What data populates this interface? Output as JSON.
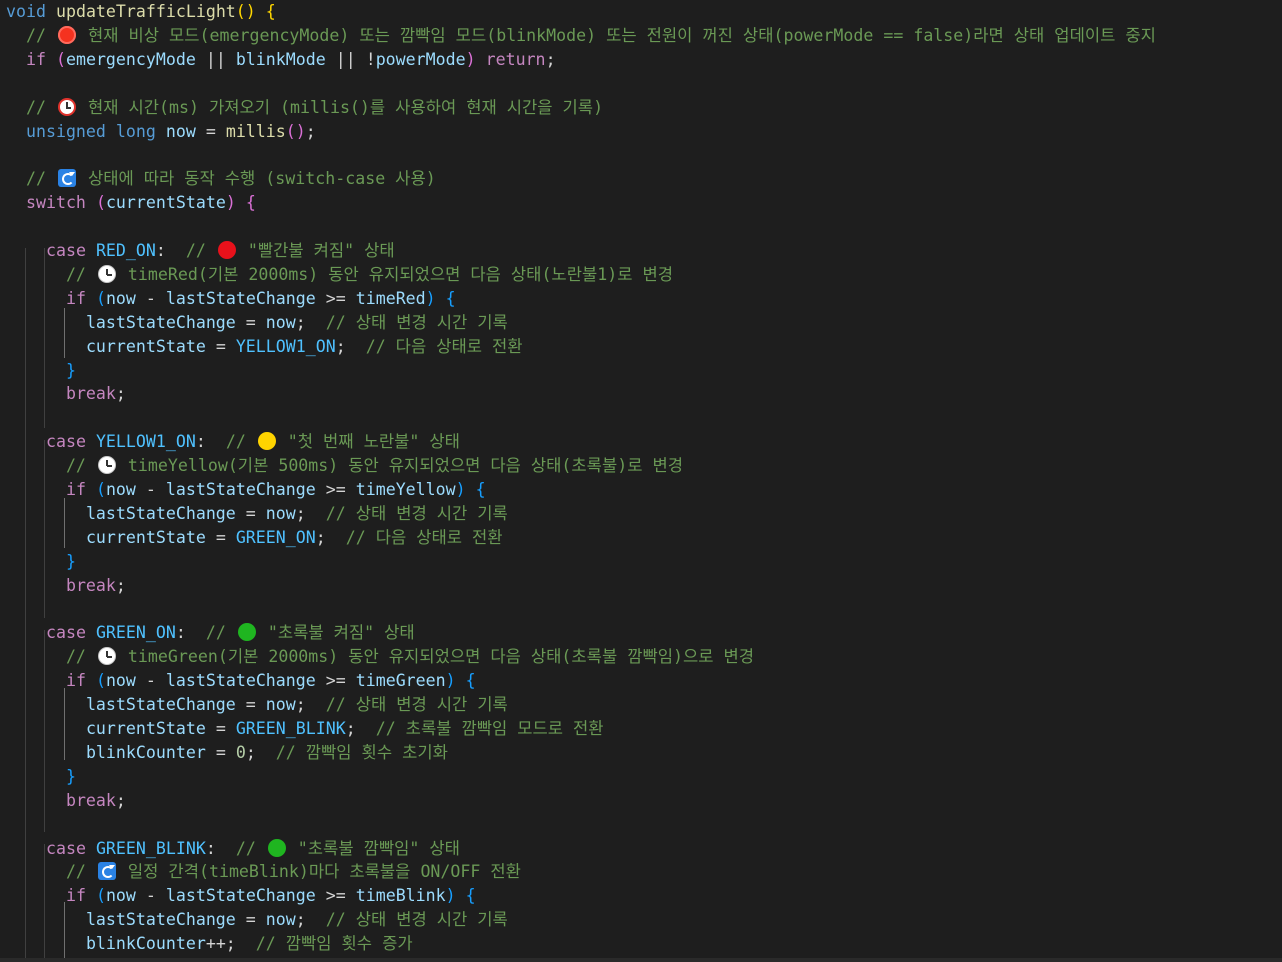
{
  "editor": {
    "theme_colors": {
      "background": "#1e1e1e",
      "keyword": "#569cd6",
      "control": "#c586c0",
      "function": "#dcdcaa",
      "variable": "#9cdcfe",
      "constant": "#4fc1ff",
      "number": "#b5cea8",
      "comment": "#6a9955",
      "string": "#ce9178"
    },
    "lines": [
      {
        "tokens": [
          [
            "kw",
            "void"
          ],
          [
            "pl",
            " "
          ],
          [
            "fn",
            "updateTrafficLight"
          ],
          [
            "br1",
            "()"
          ],
          [
            "pl",
            " "
          ],
          [
            "br1",
            "{"
          ]
        ]
      },
      {
        "tokens": [
          [
            "cmt",
            "  // "
          ],
          [
            "emoji",
            "stop"
          ],
          [
            "cmt",
            " 현재 비상 모드(emergencyMode) 또는 깜빡임 모드(blinkMode) 또는 전원이 꺼진 상태(powerMode == false)라면 상태 업데이트 중지"
          ]
        ]
      },
      {
        "tokens": [
          [
            "pl",
            "  "
          ],
          [
            "ctl",
            "if"
          ],
          [
            "pl",
            " "
          ],
          [
            "br2",
            "("
          ],
          [
            "var",
            "emergencyMode"
          ],
          [
            "pl",
            " || "
          ],
          [
            "var",
            "blinkMode"
          ],
          [
            "pl",
            " || !"
          ],
          [
            "var",
            "powerMode"
          ],
          [
            "br2",
            ")"
          ],
          [
            "pl",
            " "
          ],
          [
            "ctl",
            "return"
          ],
          [
            "pl",
            ";"
          ]
        ]
      },
      {
        "tokens": []
      },
      {
        "tokens": [
          [
            "cmt",
            "  // "
          ],
          [
            "emoji",
            "alarm"
          ],
          [
            "cmt",
            " 현재 시간(ms) 가져오기 (millis()를 사용하여 현재 시간을 기록)"
          ]
        ]
      },
      {
        "tokens": [
          [
            "pl",
            "  "
          ],
          [
            "kw",
            "unsigned long"
          ],
          [
            "pl",
            " "
          ],
          [
            "var",
            "now"
          ],
          [
            "pl",
            " = "
          ],
          [
            "fn",
            "millis"
          ],
          [
            "br2",
            "()"
          ],
          [
            "pl",
            ";"
          ]
        ]
      },
      {
        "tokens": []
      },
      {
        "tokens": [
          [
            "cmt",
            "  // "
          ],
          [
            "emoji",
            "cycle"
          ],
          [
            "cmt",
            " 상태에 따라 동작 수행 (switch-case 사용)"
          ]
        ]
      },
      {
        "tokens": [
          [
            "pl",
            "  "
          ],
          [
            "ctl",
            "switch"
          ],
          [
            "pl",
            " "
          ],
          [
            "br2",
            "("
          ],
          [
            "var",
            "currentState"
          ],
          [
            "br2",
            ")"
          ],
          [
            "pl",
            " "
          ],
          [
            "br2",
            "{"
          ]
        ]
      },
      {
        "tokens": []
      },
      {
        "tokens": [
          [
            "pl",
            "    "
          ],
          [
            "ctl",
            "case"
          ],
          [
            "pl",
            " "
          ],
          [
            "cst",
            "RED_ON"
          ],
          [
            "pl",
            ":  "
          ],
          [
            "cmt",
            "// "
          ],
          [
            "emoji",
            "red"
          ],
          [
            "cmt",
            " \"빨간불 켜짐\" 상태"
          ]
        ]
      },
      {
        "tokens": [
          [
            "cmt",
            "      // "
          ],
          [
            "emoji",
            "clock"
          ],
          [
            "cmt",
            " timeRed(기본 2000ms) 동안 유지되었으면 다음 상태(노란불1)로 변경"
          ]
        ]
      },
      {
        "tokens": [
          [
            "pl",
            "      "
          ],
          [
            "ctl",
            "if"
          ],
          [
            "pl",
            " "
          ],
          [
            "br3",
            "("
          ],
          [
            "var",
            "now"
          ],
          [
            "pl",
            " - "
          ],
          [
            "var",
            "lastStateChange"
          ],
          [
            "pl",
            " >= "
          ],
          [
            "var",
            "timeRed"
          ],
          [
            "br3",
            ")"
          ],
          [
            "pl",
            " "
          ],
          [
            "br3",
            "{"
          ]
        ]
      },
      {
        "tokens": [
          [
            "pl",
            "        "
          ],
          [
            "var",
            "lastStateChange"
          ],
          [
            "pl",
            " = "
          ],
          [
            "var",
            "now"
          ],
          [
            "pl",
            ";  "
          ],
          [
            "cmt",
            "// 상태 변경 시간 기록"
          ]
        ]
      },
      {
        "tokens": [
          [
            "pl",
            "        "
          ],
          [
            "var",
            "currentState"
          ],
          [
            "pl",
            " = "
          ],
          [
            "cst",
            "YELLOW1_ON"
          ],
          [
            "pl",
            ";  "
          ],
          [
            "cmt",
            "// 다음 상태로 전환"
          ]
        ]
      },
      {
        "tokens": [
          [
            "pl",
            "      "
          ],
          [
            "br3",
            "}"
          ]
        ]
      },
      {
        "tokens": [
          [
            "pl",
            "      "
          ],
          [
            "ctl",
            "break"
          ],
          [
            "pl",
            ";"
          ]
        ]
      },
      {
        "tokens": []
      },
      {
        "tokens": [
          [
            "pl",
            "    "
          ],
          [
            "ctl",
            "case"
          ],
          [
            "pl",
            " "
          ],
          [
            "cst",
            "YELLOW1_ON"
          ],
          [
            "pl",
            ":  "
          ],
          [
            "cmt",
            "// "
          ],
          [
            "emoji",
            "yellow"
          ],
          [
            "cmt",
            " \"첫 번째 노란불\" 상태"
          ]
        ]
      },
      {
        "tokens": [
          [
            "cmt",
            "      // "
          ],
          [
            "emoji",
            "clock"
          ],
          [
            "cmt",
            " timeYellow(기본 500ms) 동안 유지되었으면 다음 상태(초록불)로 변경"
          ]
        ]
      },
      {
        "tokens": [
          [
            "pl",
            "      "
          ],
          [
            "ctl",
            "if"
          ],
          [
            "pl",
            " "
          ],
          [
            "br3",
            "("
          ],
          [
            "var",
            "now"
          ],
          [
            "pl",
            " - "
          ],
          [
            "var",
            "lastStateChange"
          ],
          [
            "pl",
            " >= "
          ],
          [
            "var",
            "timeYellow"
          ],
          [
            "br3",
            ")"
          ],
          [
            "pl",
            " "
          ],
          [
            "br3",
            "{"
          ]
        ]
      },
      {
        "tokens": [
          [
            "pl",
            "        "
          ],
          [
            "var",
            "lastStateChange"
          ],
          [
            "pl",
            " = "
          ],
          [
            "var",
            "now"
          ],
          [
            "pl",
            ";  "
          ],
          [
            "cmt",
            "// 상태 변경 시간 기록"
          ]
        ]
      },
      {
        "tokens": [
          [
            "pl",
            "        "
          ],
          [
            "var",
            "currentState"
          ],
          [
            "pl",
            " = "
          ],
          [
            "cst",
            "GREEN_ON"
          ],
          [
            "pl",
            ";  "
          ],
          [
            "cmt",
            "// 다음 상태로 전환"
          ]
        ]
      },
      {
        "tokens": [
          [
            "pl",
            "      "
          ],
          [
            "br3",
            "}"
          ]
        ]
      },
      {
        "tokens": [
          [
            "pl",
            "      "
          ],
          [
            "ctl",
            "break"
          ],
          [
            "pl",
            ";"
          ]
        ]
      },
      {
        "tokens": []
      },
      {
        "tokens": [
          [
            "pl",
            "    "
          ],
          [
            "ctl",
            "case"
          ],
          [
            "pl",
            " "
          ],
          [
            "cst",
            "GREEN_ON"
          ],
          [
            "pl",
            ":  "
          ],
          [
            "cmt",
            "// "
          ],
          [
            "emoji",
            "green"
          ],
          [
            "cmt",
            " \"초록불 켜짐\" 상태"
          ]
        ]
      },
      {
        "tokens": [
          [
            "cmt",
            "      // "
          ],
          [
            "emoji",
            "clock"
          ],
          [
            "cmt",
            " timeGreen(기본 2000ms) 동안 유지되었으면 다음 상태(초록불 깜빡임)으로 변경"
          ]
        ]
      },
      {
        "tokens": [
          [
            "pl",
            "      "
          ],
          [
            "ctl",
            "if"
          ],
          [
            "pl",
            " "
          ],
          [
            "br3",
            "("
          ],
          [
            "var",
            "now"
          ],
          [
            "pl",
            " - "
          ],
          [
            "var",
            "lastStateChange"
          ],
          [
            "pl",
            " >= "
          ],
          [
            "var",
            "timeGreen"
          ],
          [
            "br3",
            ")"
          ],
          [
            "pl",
            " "
          ],
          [
            "br3",
            "{"
          ]
        ]
      },
      {
        "tokens": [
          [
            "pl",
            "        "
          ],
          [
            "var",
            "lastStateChange"
          ],
          [
            "pl",
            " = "
          ],
          [
            "var",
            "now"
          ],
          [
            "pl",
            ";  "
          ],
          [
            "cmt",
            "// 상태 변경 시간 기록"
          ]
        ]
      },
      {
        "tokens": [
          [
            "pl",
            "        "
          ],
          [
            "var",
            "currentState"
          ],
          [
            "pl",
            " = "
          ],
          [
            "cst",
            "GREEN_BLINK"
          ],
          [
            "pl",
            ";  "
          ],
          [
            "cmt",
            "// 초록불 깜빡임 모드로 전환"
          ]
        ]
      },
      {
        "tokens": [
          [
            "pl",
            "        "
          ],
          [
            "var",
            "blinkCounter"
          ],
          [
            "pl",
            " = "
          ],
          [
            "num",
            "0"
          ],
          [
            "pl",
            ";  "
          ],
          [
            "cmt",
            "// 깜빡임 횟수 초기화"
          ]
        ]
      },
      {
        "tokens": [
          [
            "pl",
            "      "
          ],
          [
            "br3",
            "}"
          ]
        ]
      },
      {
        "tokens": [
          [
            "pl",
            "      "
          ],
          [
            "ctl",
            "break"
          ],
          [
            "pl",
            ";"
          ]
        ]
      },
      {
        "tokens": []
      },
      {
        "tokens": [
          [
            "pl",
            "    "
          ],
          [
            "ctl",
            "case"
          ],
          [
            "pl",
            " "
          ],
          [
            "cst",
            "GREEN_BLINK"
          ],
          [
            "pl",
            ":  "
          ],
          [
            "cmt",
            "// "
          ],
          [
            "emoji",
            "green"
          ],
          [
            "cmt",
            " \"초록불 깜빡임\" 상태"
          ]
        ]
      },
      {
        "tokens": [
          [
            "cmt",
            "      // "
          ],
          [
            "emoji",
            "cycle"
          ],
          [
            "cmt",
            " 일정 간격(timeBlink)마다 초록불을 ON/OFF 전환"
          ]
        ]
      },
      {
        "tokens": [
          [
            "pl",
            "      "
          ],
          [
            "ctl",
            "if"
          ],
          [
            "pl",
            " "
          ],
          [
            "br3",
            "("
          ],
          [
            "var",
            "now"
          ],
          [
            "pl",
            " - "
          ],
          [
            "var",
            "lastStateChange"
          ],
          [
            "pl",
            " >= "
          ],
          [
            "var",
            "timeBlink"
          ],
          [
            "br3",
            ")"
          ],
          [
            "pl",
            " "
          ],
          [
            "br3",
            "{"
          ]
        ]
      },
      {
        "tokens": [
          [
            "pl",
            "        "
          ],
          [
            "var",
            "lastStateChange"
          ],
          [
            "pl",
            " = "
          ],
          [
            "var",
            "now"
          ],
          [
            "pl",
            ";  "
          ],
          [
            "cmt",
            "// 상태 변경 시간 기록"
          ]
        ]
      },
      {
        "tokens": [
          [
            "pl",
            "        "
          ],
          [
            "var",
            "blinkCounter"
          ],
          [
            "pl",
            "++;  "
          ],
          [
            "cmt",
            "// 깜빡임 횟수 증가"
          ]
        ]
      }
    ]
  }
}
